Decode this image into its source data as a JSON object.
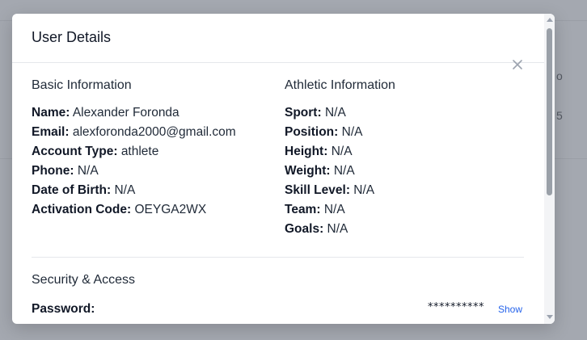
{
  "background": {
    "right_text_1": "o",
    "right_text_2": "5"
  },
  "modal": {
    "title": "User Details",
    "close_icon": "close-icon"
  },
  "basic_info": {
    "title": "Basic Information",
    "fields": [
      {
        "label": "Name:",
        "value": "Alexander Foronda"
      },
      {
        "label": "Email:",
        "value": "alexforonda2000@gmail.com"
      },
      {
        "label": "Account Type:",
        "value": "athlete"
      },
      {
        "label": "Phone:",
        "value": "N/A"
      },
      {
        "label": "Date of Birth:",
        "value": "N/A"
      },
      {
        "label": "Activation Code:",
        "value": "OEYGA2WX"
      }
    ]
  },
  "athletic_info": {
    "title": "Athletic Information",
    "fields": [
      {
        "label": "Sport:",
        "value": "N/A"
      },
      {
        "label": "Position:",
        "value": "N/A"
      },
      {
        "label": "Height:",
        "value": "N/A"
      },
      {
        "label": "Weight:",
        "value": "N/A"
      },
      {
        "label": "Skill Level:",
        "value": "N/A"
      },
      {
        "label": "Team:",
        "value": "N/A"
      },
      {
        "label": "Goals:",
        "value": "N/A"
      }
    ]
  },
  "security": {
    "title": "Security & Access",
    "password_label": "Password:",
    "password_mask": "**********",
    "show_label": "Show"
  },
  "colors": {
    "overlay": "#a4a8b0",
    "link": "#2563eb",
    "divider": "#e5e7eb"
  }
}
